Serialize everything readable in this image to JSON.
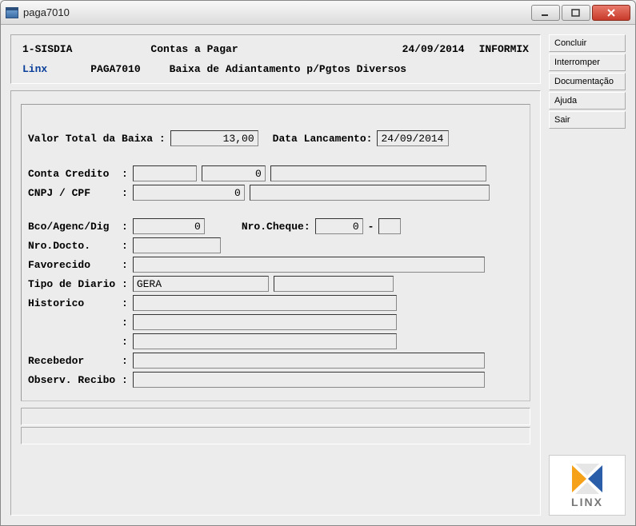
{
  "window": {
    "title": "paga7010"
  },
  "sidebar": {
    "buttons": {
      "concluir": "Concluir",
      "interromper": "Interromper",
      "documentacao": "Documentação",
      "ajuda": "Ajuda",
      "sair": "Sair"
    },
    "logo_text": "LINX"
  },
  "header": {
    "env": "1-SISDIA",
    "module_title": "Contas a Pagar",
    "date": "24/09/2014",
    "system": "INFORMIX",
    "brand": "Linx",
    "program_code": "PAGA7010",
    "subtitle": "Baixa de Adiantamento p/Pgtos Diversos"
  },
  "form": {
    "labels": {
      "valor_total": "Valor Total da Baixa :",
      "data_lancamento": "Data Lancamento:",
      "conta_credito": "Conta Credito  :",
      "cnpj_cpf": "CNPJ / CPF     :",
      "bco_agenc_dig": "Bco/Agenc/Dig  :",
      "nro_cheque": "Nro.Cheque:",
      "nro_docto": "Nro.Docto.     :",
      "favorecido": "Favorecido     :",
      "tipo_diario": "Tipo de Diario :",
      "historico": "Historico      :",
      "historico2": "               :",
      "historico3": "               :",
      "recebedor": "Recebedor      :",
      "observ_recibo": "Observ. Recibo :"
    },
    "values": {
      "valor_total": "13,00",
      "data_lancamento": "24/09/2014",
      "conta_credito_1": "",
      "conta_credito_2": "0",
      "conta_credito_desc": "",
      "cnpj_cpf": "0",
      "cnpj_cpf_desc": "",
      "bco_agenc_dig": "0",
      "nro_cheque": "0",
      "nro_cheque_suf": "",
      "nro_docto": "",
      "favorecido": "",
      "tipo_diario": "GERA",
      "tipo_diario_desc": "",
      "historico1": "",
      "historico2": "",
      "historico3": "",
      "recebedor": "",
      "observ_recibo": ""
    }
  }
}
